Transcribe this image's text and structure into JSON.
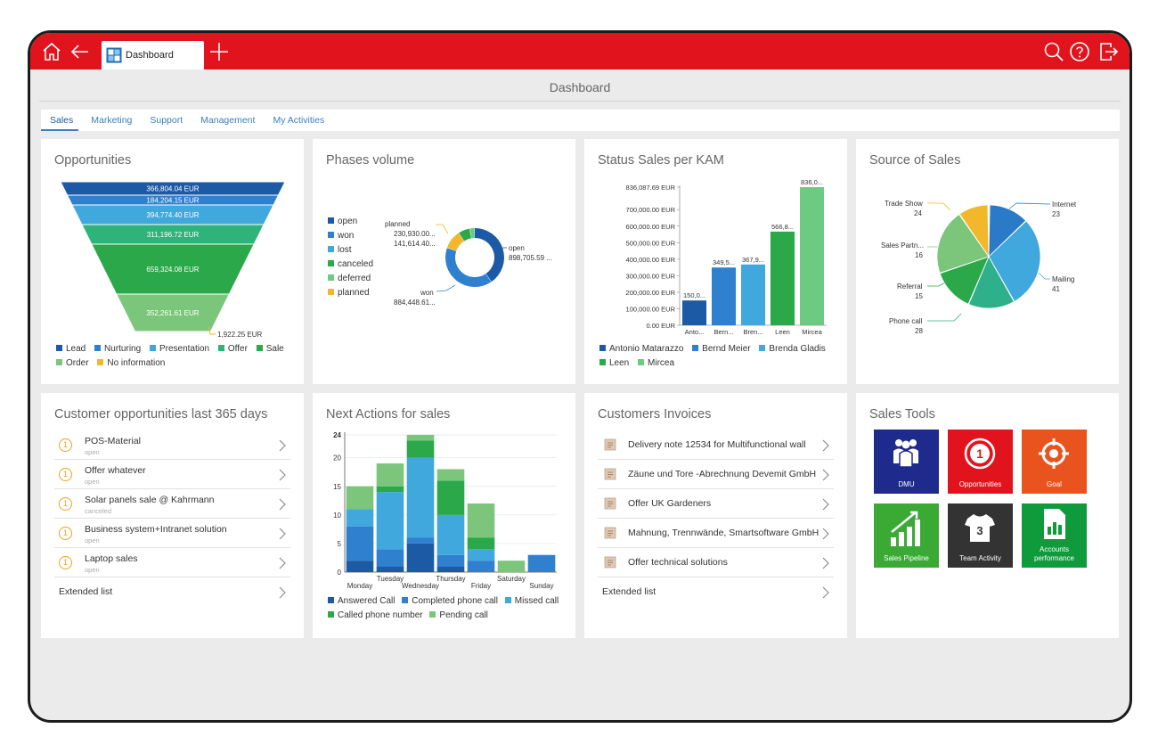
{
  "topbar": {
    "tab_label": "Dashboard",
    "colors": {
      "bar": "#e1141e"
    },
    "icons": [
      "home-icon",
      "back-arrow-icon",
      "dashboard-tab-icon",
      "plus-icon",
      "search-icon",
      "help-icon",
      "logout-icon"
    ]
  },
  "page_title": "Dashboard",
  "subtabs": [
    "Sales",
    "Marketing",
    "Support",
    "Management",
    "My Activities"
  ],
  "opportunities": {
    "title": "Opportunities",
    "labels": [
      "366,804.04 EUR",
      "184,204.15 EUR",
      "394,774.40 EUR",
      "311,196.72 EUR",
      "659,324.08 EUR",
      "352,261.61 EUR",
      "1,922.25 EUR"
    ],
    "legend": [
      "Lead",
      "Nurturing",
      "Presentation",
      "Offer",
      "Sale",
      "Order",
      "No information"
    ],
    "colors": [
      "#1c5aa6",
      "#3080d0",
      "#40a8dc",
      "#2eb47a",
      "#2aa84a",
      "#7cc67c",
      "#f2b72a"
    ]
  },
  "phases": {
    "title": "Phases volume",
    "legend": [
      "open",
      "won",
      "lost",
      "canceled",
      "deferred",
      "planned"
    ],
    "colors": [
      "#1c5aa6",
      "#3080d0",
      "#40a8dc",
      "#2aa84a",
      "#6ccb80",
      "#f2b72a"
    ],
    "callouts": {
      "open": "open",
      "open_value": "898,705.59 ...",
      "won": "won",
      "won_value": "884,448.61...",
      "planned": "planned",
      "v1": "230,930.00...",
      "v2": "141,614.40..."
    }
  },
  "kam": {
    "title": "Status Sales per KAM",
    "y_ticks": [
      "836,087.69 EUR",
      "700,000.00 EUR",
      "600,000.00 EUR",
      "500,000.00 EUR",
      "400,000.00 EUR",
      "300,000.00 EUR",
      "200,000.00 EUR",
      "100,000.00 EUR",
      "0.00 EUR"
    ],
    "x_labels": [
      "Anto...",
      "Bern...",
      "Bren...",
      "Leen",
      "Mircea"
    ],
    "value_labels": [
      "150,0...",
      "349,5...",
      "367,9...",
      "566,8...",
      "836,0..."
    ],
    "legend": [
      "Antonio Matarazzo",
      "Bernd Meier",
      "Brenda Gladis",
      "Leen",
      "Mircea"
    ],
    "colors": [
      "#1c5aa6",
      "#3080d0",
      "#40a8dc",
      "#2aa84a",
      "#6ccb80"
    ]
  },
  "sources": {
    "title": "Source of Sales",
    "labels": [
      {
        "name": "Trade Show",
        "value": "24"
      },
      {
        "name": "Internet",
        "value": "23"
      },
      {
        "name": "Sales Partn...",
        "value": "16"
      },
      {
        "name": "Referral",
        "value": "15"
      },
      {
        "name": "Mailing",
        "value": "41"
      },
      {
        "name": "Phone call",
        "value": "28"
      }
    ]
  },
  "customer_opps": {
    "title": "Customer opportunities last 365 days",
    "items": [
      {
        "badge": "1",
        "title": "POS-Material",
        "status": "open"
      },
      {
        "badge": "1",
        "title": "Offer whatever",
        "status": "open"
      },
      {
        "badge": "1",
        "title": "Solar panels sale @ Kahrmann",
        "status": "canceled"
      },
      {
        "badge": "1",
        "title": "Business system+Intranet solution",
        "status": "open"
      },
      {
        "badge": "1",
        "title": "Laptop sales",
        "status": "open"
      }
    ],
    "extended": "Extended list"
  },
  "next_actions": {
    "title": "Next Actions for sales",
    "y_ticks": [
      "24",
      "20",
      "15",
      "10",
      "5",
      "0"
    ],
    "days": [
      "Monday",
      "Tuesday",
      "Wednesday",
      "Thursday",
      "Friday",
      "Saturday",
      "Sunday"
    ],
    "legend": [
      "Answered Call",
      "Completed phone call",
      "Missed call",
      "Called phone number",
      "Pending call"
    ],
    "colors": [
      "#1c5aa6",
      "#3080d0",
      "#40a8dc",
      "#2aa84a",
      "#7cc67c"
    ]
  },
  "invoices": {
    "title": "Customers Invoices",
    "items": [
      "Delivery note 12534 for Multifunctional wall",
      "Zäune und Tore -Abrechnung Devemit GmbH",
      "Offer UK Gardeners",
      "Mahnung, Trennwände, Smartsoftware GmbH",
      "Offer technical solutions"
    ],
    "extended": "Extended list"
  },
  "sales_tools": {
    "title": "Sales Tools",
    "tiles": [
      {
        "label": "DMU",
        "color": "#1e2a8c",
        "icon": "people-icon"
      },
      {
        "label": "Opportunities",
        "color": "#e1141e",
        "icon": "opportunity-badge-icon",
        "badge": "1"
      },
      {
        "label": "Goal",
        "color": "#e8531e",
        "icon": "target-icon"
      },
      {
        "label": "Sales Pipeline",
        "color": "#3aaa35",
        "icon": "growth-chart-icon"
      },
      {
        "label": "Team Activity",
        "color": "#333333",
        "icon": "shirt-icon",
        "badge": "3"
      },
      {
        "label": "Accounts performance",
        "color": "#0f9a3c",
        "icon": "document-chart-icon"
      }
    ]
  },
  "chart_data": [
    {
      "type": "bar",
      "title": "Opportunities",
      "categories": [
        "Lead",
        "Nurturing",
        "Presentation",
        "Offer",
        "Sale",
        "Order",
        "No information"
      ],
      "values": [
        366804.04,
        184204.15,
        394774.4,
        311196.72,
        659324.08,
        352261.61,
        1922.25
      ]
    },
    {
      "type": "pie",
      "title": "Phases volume",
      "categories": [
        "open",
        "won",
        "planned",
        "canceled",
        "deferred"
      ],
      "values": [
        898705.59,
        884448.61,
        230930.0,
        141614.4,
        60000
      ]
    },
    {
      "type": "bar",
      "title": "Status Sales per KAM",
      "categories": [
        "Antonio Matarazzo",
        "Bernd Meier",
        "Brenda Gladis",
        "Leen",
        "Mircea"
      ],
      "values": [
        150000,
        349500,
        367900,
        566800,
        836087.69
      ],
      "ylim": [
        0,
        836087.69
      ]
    },
    {
      "type": "pie",
      "title": "Source of Sales",
      "categories": [
        "Trade Show",
        "Internet",
        "Mailing",
        "Phone call",
        "Referral",
        "Sales Partn..."
      ],
      "values": [
        24,
        23,
        41,
        28,
        15,
        16
      ]
    },
    {
      "type": "bar",
      "title": "Next Actions for sales",
      "categories": [
        "Monday",
        "Tuesday",
        "Wednesday",
        "Thursday",
        "Friday",
        "Saturday",
        "Sunday"
      ],
      "ylim": [
        0,
        24
      ],
      "series": [
        {
          "name": "Answered Call",
          "values": [
            2,
            1,
            5,
            1,
            0,
            0,
            0
          ]
        },
        {
          "name": "Completed phone call",
          "values": [
            6,
            3,
            1,
            2,
            2,
            0,
            3
          ]
        },
        {
          "name": "Missed call",
          "values": [
            3,
            10,
            14,
            7,
            2,
            0,
            0
          ]
        },
        {
          "name": "Called phone number",
          "values": [
            0,
            1,
            3,
            6,
            2,
            0,
            0
          ]
        },
        {
          "name": "Pending call",
          "values": [
            4,
            4,
            1,
            2,
            6,
            2,
            0
          ]
        }
      ]
    }
  ]
}
